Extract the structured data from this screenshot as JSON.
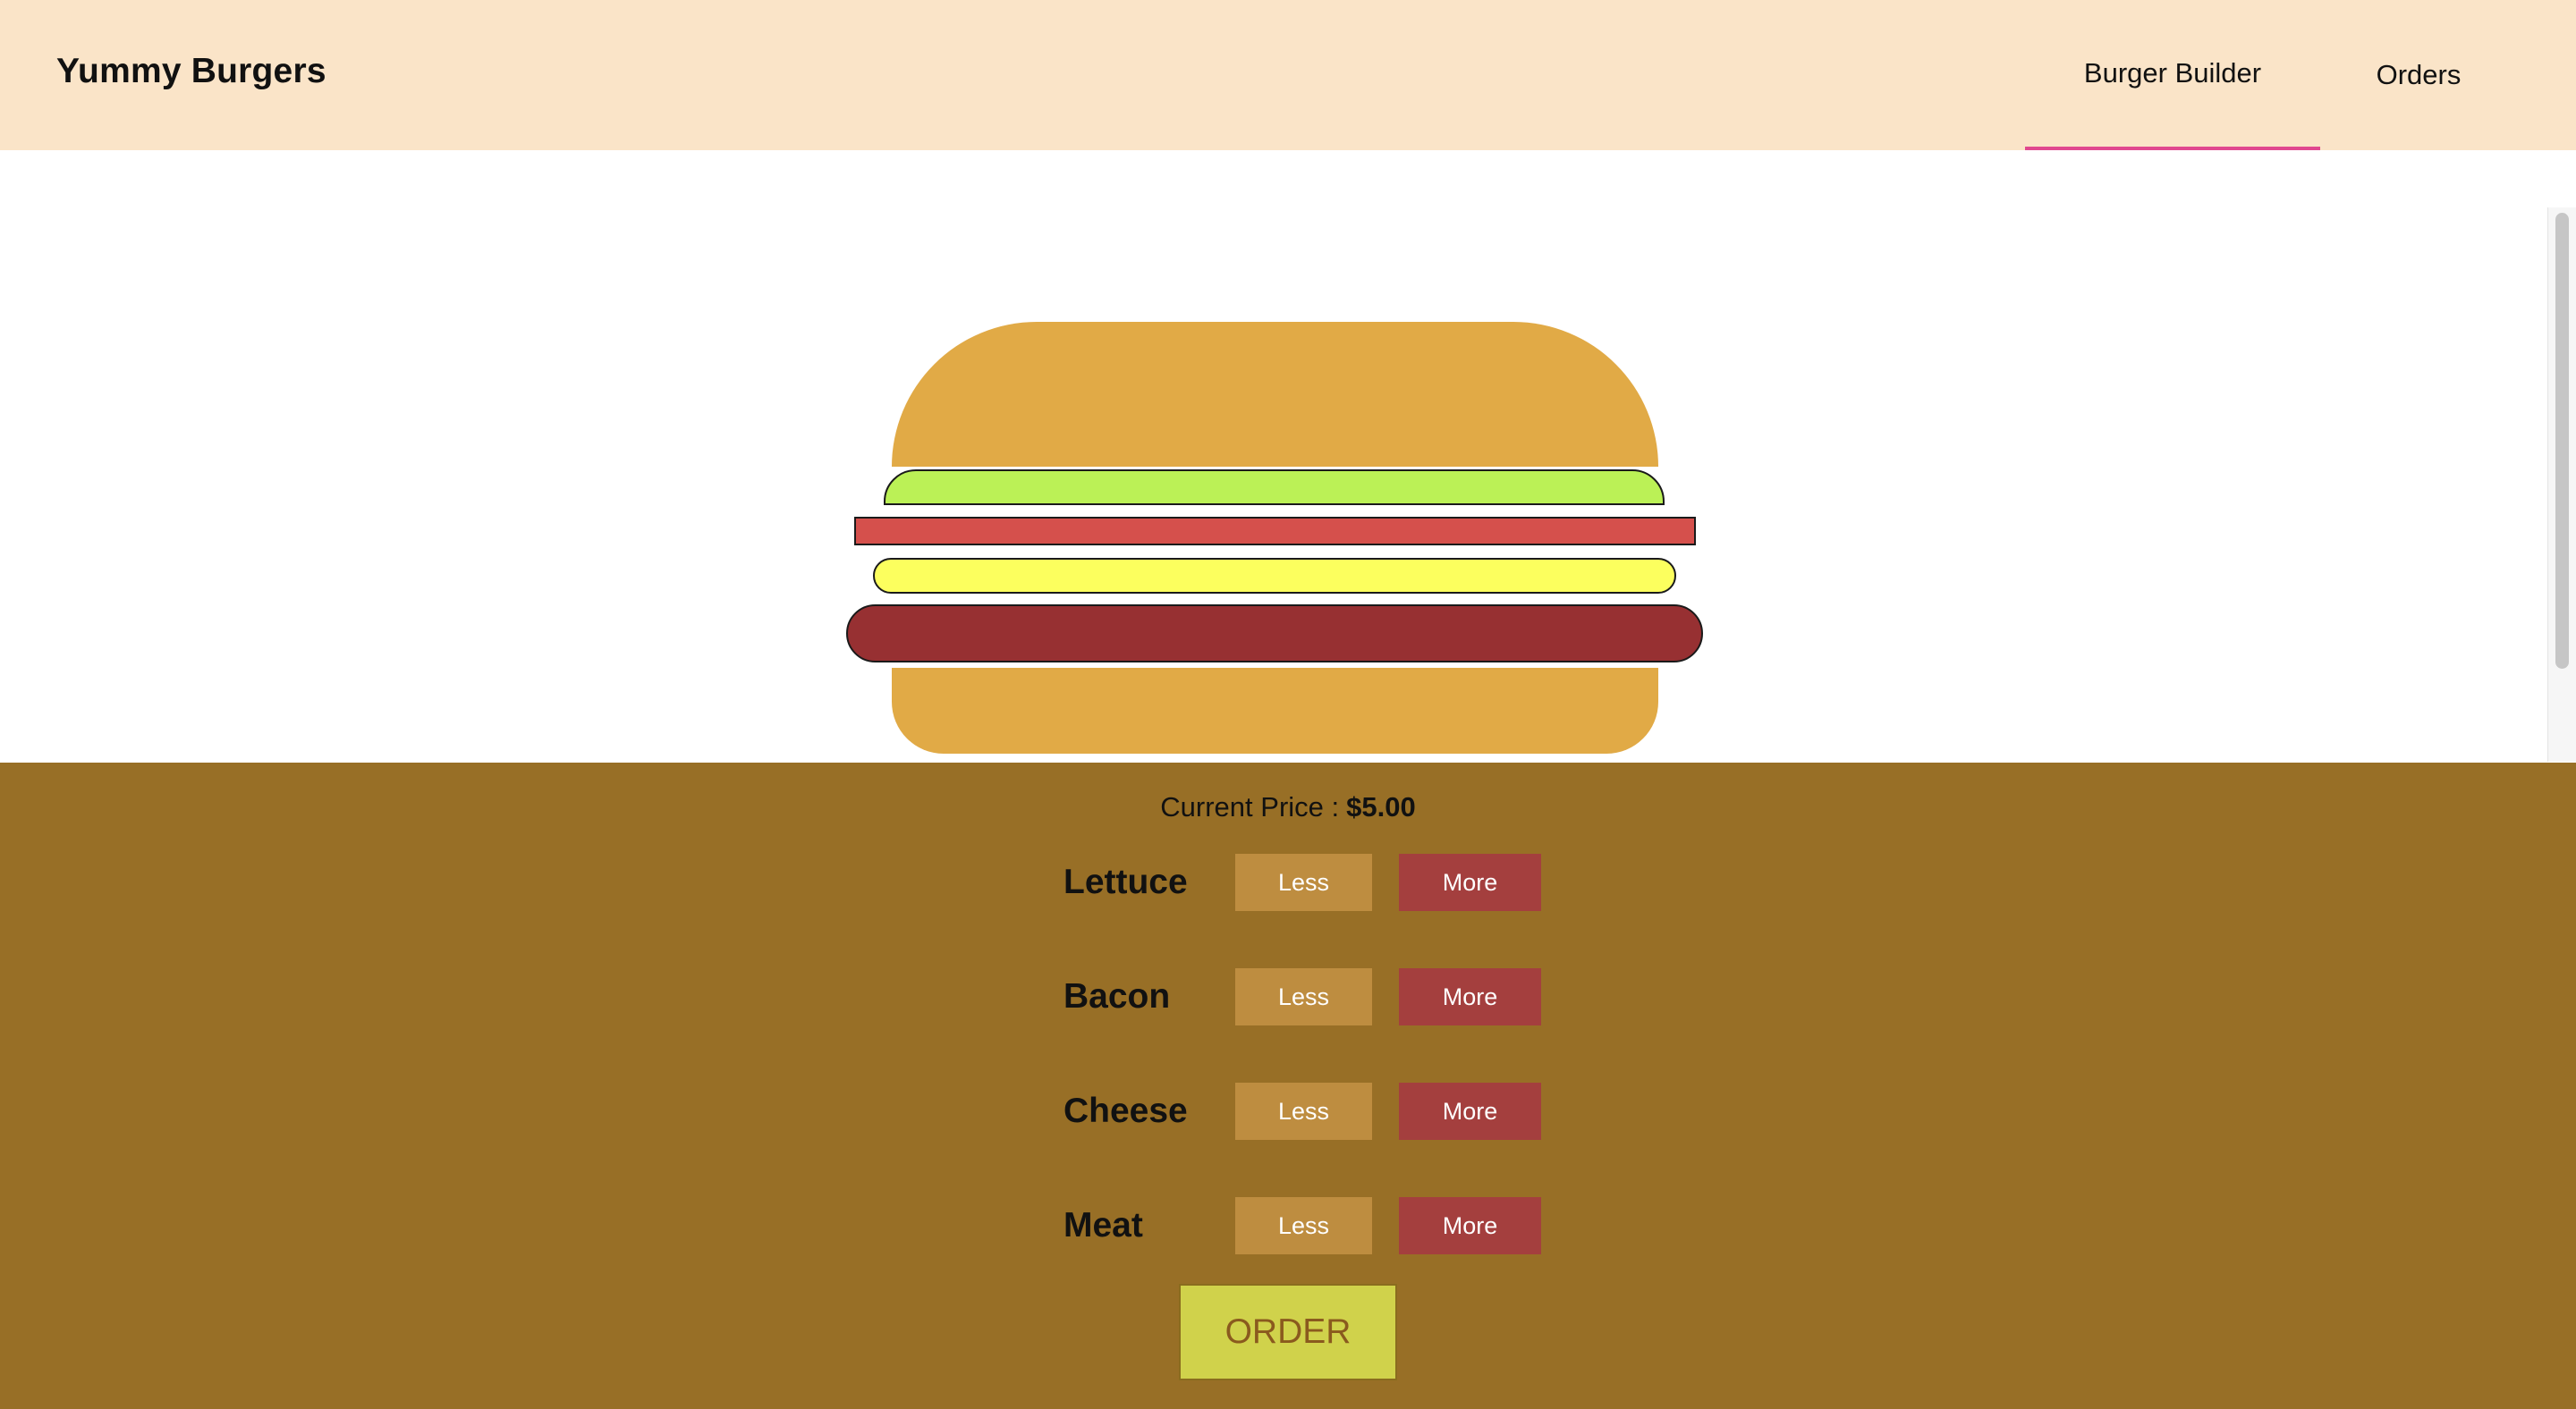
{
  "header": {
    "brand": "Yummy Burgers",
    "nav": [
      {
        "label": "Burger Builder",
        "active": true
      },
      {
        "label": "Orders",
        "active": false
      }
    ],
    "active_indicator_color": "#E0478F",
    "background": "#FAE4C8"
  },
  "burger": {
    "layers": [
      "bread-top",
      "lettuce",
      "bacon",
      "cheese",
      "meat",
      "bread-bottom"
    ],
    "colors": {
      "bread": "#E1AA46",
      "lettuce": "#BBF156",
      "bacon": "#D5504C",
      "cheese": "#FCFF5E",
      "meat": "#973032"
    }
  },
  "controls": {
    "price_label": "Current Price :",
    "price_value": "$5.00",
    "ingredients": [
      {
        "label": "Lettuce",
        "less": "Less",
        "more": "More"
      },
      {
        "label": "Bacon",
        "less": "Less",
        "more": "More"
      },
      {
        "label": "Cheese",
        "less": "Less",
        "more": "More"
      },
      {
        "label": "Meat",
        "less": "Less",
        "more": "More"
      }
    ],
    "order_label": "ORDER",
    "background": "#986F26"
  }
}
